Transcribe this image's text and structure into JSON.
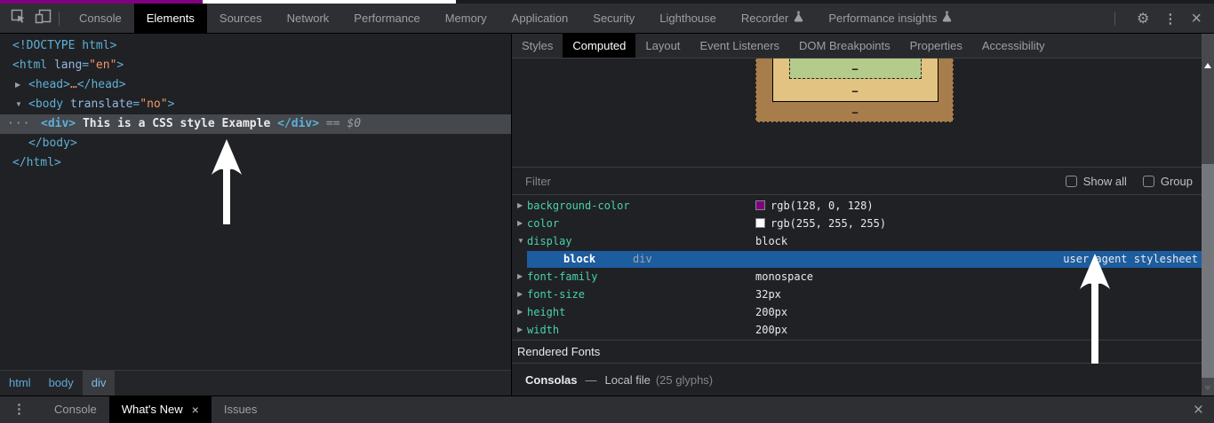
{
  "top_sliver": {
    "left_color": "#800080",
    "right_color": "#ffffff"
  },
  "toolbar": {
    "tabs": [
      "Console",
      "Elements",
      "Sources",
      "Network",
      "Performance",
      "Memory",
      "Application",
      "Security",
      "Lighthouse",
      "Recorder",
      "Performance insights"
    ],
    "active_tab": "Elements",
    "settings_glyph": "⚙",
    "more_glyph": "⋮",
    "close_glyph": "×"
  },
  "elements_panel": {
    "tree": {
      "doctype": "<!DOCTYPE html>",
      "html_open": {
        "tag_open": "<html",
        "attr": " lang",
        "eq": "=",
        "value": "\"en\"",
        "close": ">"
      },
      "head": {
        "open": "<head>",
        "ellipsis": "…",
        "close": "</head>"
      },
      "body_open": {
        "tag_open": "<body",
        "attr": " translate",
        "eq": "=",
        "value": "\"no\"",
        "close": ">"
      },
      "div_row": {
        "dots": "···",
        "open": "<div>",
        "text": " This is a CSS style Example ",
        "close": "</div>",
        "eq": " == ",
        "dollar": "$0"
      },
      "body_close": "</body>",
      "html_close": "</html>"
    },
    "breadcrumbs": [
      "html",
      "body",
      "div"
    ],
    "selected_breadcrumb": "div"
  },
  "sidebar": {
    "tabs": [
      "Styles",
      "Computed",
      "Layout",
      "Event Listeners",
      "DOM Breakpoints",
      "Properties",
      "Accessibility"
    ],
    "active_tab": "Computed",
    "box_model": {
      "margin_dash": "−",
      "border_dash": "−",
      "padding_dash": "−",
      "margin_color": "#a87d4c",
      "border_color": "#e3c381",
      "padding_color": "#b5cb8b"
    },
    "filter": {
      "placeholder": "Filter",
      "show_all_label": "Show all",
      "group_label": "Group"
    },
    "computed": {
      "properties": [
        {
          "name": "background-color",
          "value": "rgb(128, 0, 128)",
          "swatch": "#800080",
          "swatch_style": "background-color:#800080"
        },
        {
          "name": "color",
          "value": "rgb(255, 255, 255)",
          "swatch": "#ffffff",
          "swatch_style": "background-color:#ffffff"
        },
        {
          "name": "display",
          "value": "block"
        },
        {
          "name": "font-family",
          "value": "monospace"
        },
        {
          "name": "font-size",
          "value": "32px"
        },
        {
          "name": "height",
          "value": "200px"
        },
        {
          "name": "width",
          "value": "200px"
        }
      ],
      "trace": {
        "value": "block",
        "selector": "div",
        "origin": "user agent stylesheet"
      }
    },
    "rendered_fonts": {
      "header": "Rendered Fonts",
      "family": "Consolas",
      "separator": "—",
      "source": "Local file",
      "glyphs": "(25 glyphs)"
    }
  },
  "drawer": {
    "more_glyph": "⋮",
    "tabs": [
      "Console",
      "What's New",
      "Issues"
    ],
    "active_tab": "What's New",
    "tab_close_glyph": "×",
    "close_glyph": "×"
  },
  "glyphs": {
    "collapsed": "▶",
    "expanded": "▼"
  },
  "theme": {
    "toolbar_bg": "#2d2f33",
    "panel_bg": "#202124",
    "selection_blue": "#1d5c9e",
    "selected_node_bg": "#45484d",
    "tag_blue": "#5db0d7",
    "attr_blue": "#93b8e1",
    "value_orange": "#f29766",
    "property_teal": "#48d1b0"
  }
}
